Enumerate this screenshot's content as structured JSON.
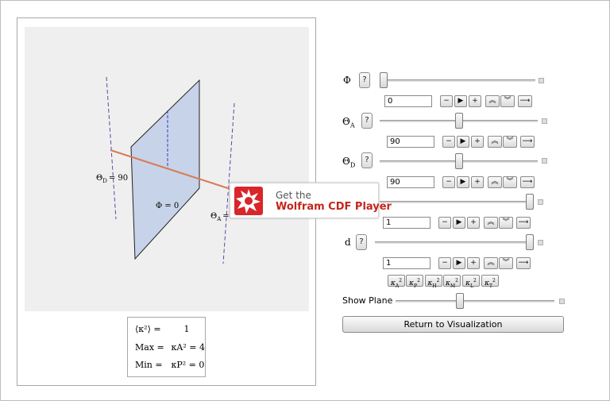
{
  "cdf_banner": {
    "get_the": "Get the",
    "product": "Wolfram CDF Player",
    "accent": "#c4261d"
  },
  "graphics": {
    "theta_d_label": "Θ",
    "theta_d_sub": "D",
    "theta_d_value": "= 90",
    "phi_label": "Φ = 0",
    "theta_a_label": "Θ",
    "theta_a_sub": "A",
    "theta_a_value": "= 90",
    "plane_fill": "#c7d3e8",
    "axis_color": "#d97a55",
    "dash_color": "#5a4aa0"
  },
  "legend": {
    "row1_label": "⟨κ²⟩ =",
    "row1_value": "1",
    "row2_label": "Max =",
    "row2_value": "κA² = 4",
    "row3_label": "Min =",
    "row3_value": "κP² = 0"
  },
  "controls": {
    "phi": {
      "label": "Φ",
      "value": "0",
      "level": 0.0
    },
    "theta_a": {
      "label": "Θ",
      "sub": "A",
      "value": "90",
      "level": 0.5
    },
    "theta_d": {
      "label": "Θ",
      "sub": "D",
      "value": "90",
      "level": 0.5
    },
    "unlabeled": {
      "value": "1",
      "level": 1.0
    },
    "d": {
      "label": "d",
      "value": "1",
      "level": 1.0
    },
    "help": "?",
    "step_minus": "−",
    "step_play": "▶",
    "step_plus": "+",
    "faster": "︽",
    "slower": "︾",
    "direction": "⟶"
  },
  "kappa_buttons": [
    {
      "base": "κ",
      "sub": "A",
      "sup": "2"
    },
    {
      "base": "κ",
      "sub": "P",
      "sup": "2"
    },
    {
      "base": "κ",
      "sub": "H",
      "sup": "2"
    },
    {
      "base": "κ",
      "sub": "M",
      "sup": "2"
    },
    {
      "base": "κ",
      "sub": "L",
      "sup": "2"
    },
    {
      "base": "κ",
      "sub": "T",
      "sup": "2"
    }
  ],
  "show_plane": {
    "label": "Show Plane",
    "level": 0.4
  },
  "return_button": "Return to Visualization"
}
